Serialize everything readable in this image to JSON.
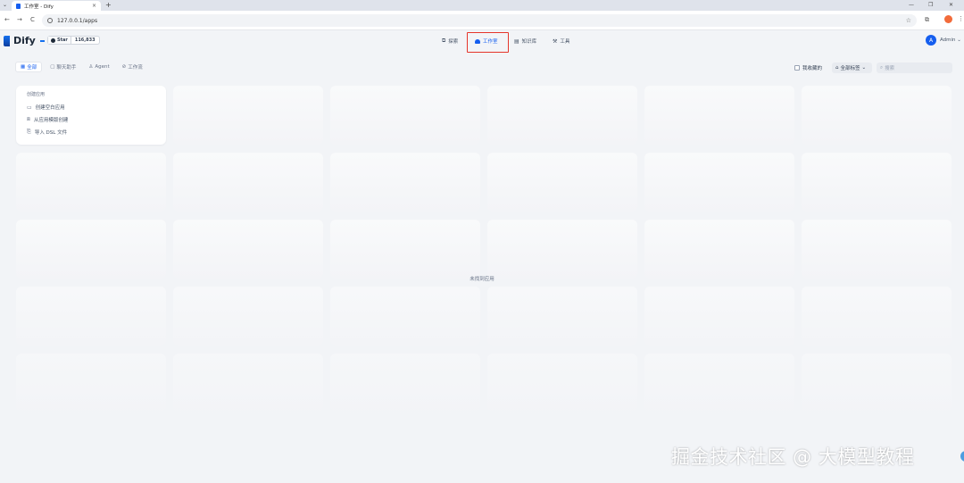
{
  "browser": {
    "tab_title": "工作室 - Dify",
    "tab_close": "×",
    "new_tab": "+",
    "url": "127.0.0.1/apps",
    "tab_menu": "⌄",
    "back": "←",
    "forward": "→",
    "reload": "C",
    "star": "☆",
    "minimize": "—",
    "restore": "❐",
    "close": "✕",
    "extension": "⧉",
    "menu": "⋮"
  },
  "header": {
    "logo_text": "Dify",
    "github_label": "Star",
    "github_count": "116,833",
    "nav": [
      {
        "label": "探索",
        "icon": "⧉"
      },
      {
        "label": "工作室",
        "icon": "workspace"
      },
      {
        "label": "知识库",
        "icon": "▤"
      },
      {
        "label": "工具",
        "icon": "⚒"
      }
    ],
    "avatar_initial": "A",
    "user_name": "Admin",
    "user_caret": "⌄"
  },
  "filters": [
    {
      "label": "全部",
      "icon": "▦"
    },
    {
      "label": "聊天助手",
      "icon": "▢"
    },
    {
      "label": "Agent",
      "icon": "♙"
    },
    {
      "label": "工作流",
      "icon": "⊘"
    }
  ],
  "toolbar": {
    "favorites_label": "我收藏的",
    "tag_filter_label": "全部标签",
    "tag_icon": "⌂",
    "tag_caret": "⌄",
    "search_placeholder": "搜索",
    "search_icon": "⌕"
  },
  "create_card": {
    "title": "创建应用",
    "items": [
      {
        "label": "创建空白应用",
        "icon": "▭"
      },
      {
        "label": "从应用模版创建",
        "icon": "⧈"
      },
      {
        "label": "导入 DSL 文件",
        "icon": "⎘"
      }
    ]
  },
  "empty_state": "未找到应用",
  "watermark": "掘金技术社区 @ 大模型教程",
  "colors": {
    "accent": "#155eef",
    "highlight": "#e5352b",
    "background": "#f2f4f7"
  }
}
